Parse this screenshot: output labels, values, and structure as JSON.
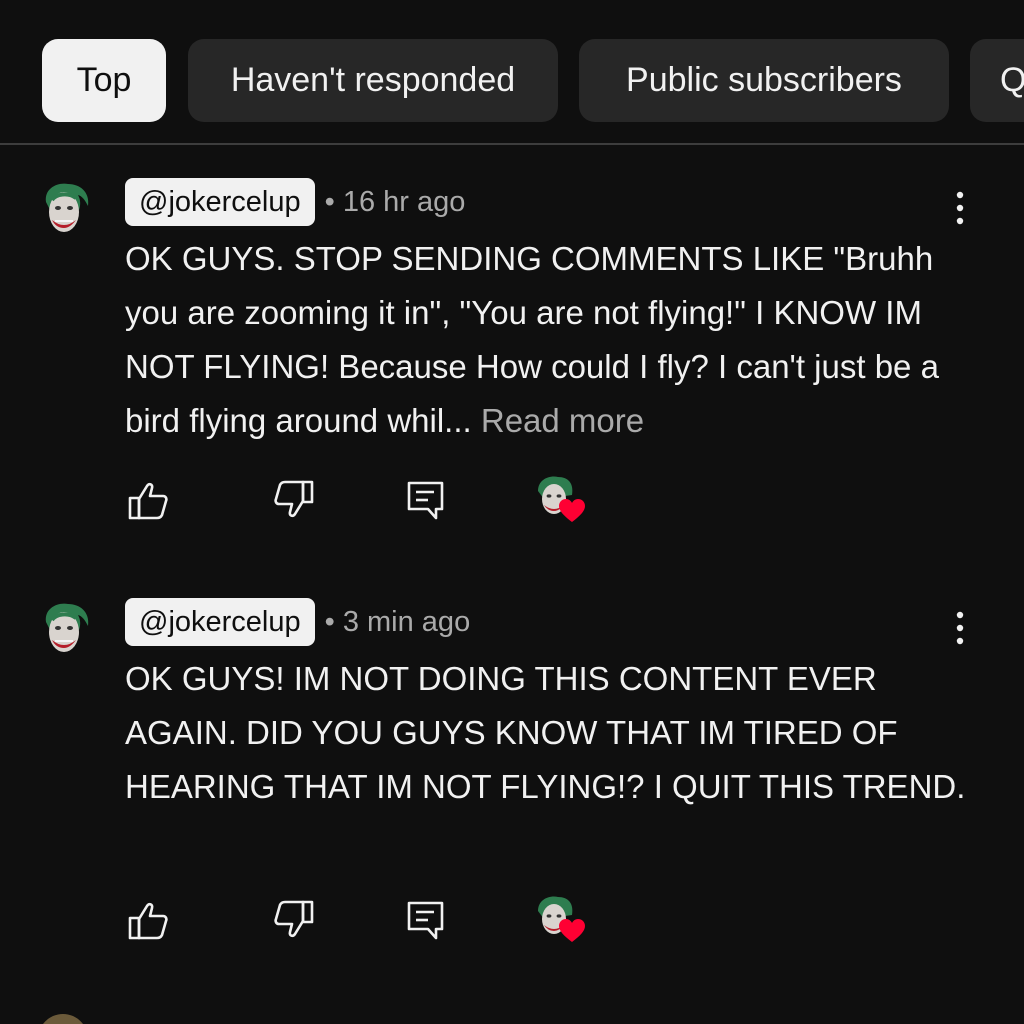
{
  "filters": {
    "chips": [
      {
        "label": "Top",
        "active": true
      },
      {
        "label": "Haven't responded",
        "active": false
      },
      {
        "label": "Public subscribers",
        "active": false
      },
      {
        "label": "Q",
        "active": false
      }
    ]
  },
  "comments": [
    {
      "author": "@jokercelup",
      "time": "• 16 hr ago",
      "text": "OK GUYS. STOP SENDING COMMENTS LIKE \"Bruhh you are zooming it in\", \"You are not flying!\" I KNOW IM NOT FLYING! Because How could I fly? I can't just be a bird flying around whil...",
      "read_more": "Read more",
      "hearted": true
    },
    {
      "author": "@jokercelup",
      "time": "• 3 min ago",
      "text": "OK GUYS! IM NOT DOING THIS CONTENT EVER AGAIN. DID YOU GUYS KNOW THAT IM TIRED OF HEARING THAT IM NOT FLYING!?  I QUIT THIS TREND.",
      "read_more": "",
      "hearted": true
    }
  ],
  "icons": {
    "like": "thumb-up-icon",
    "dislike": "thumb-down-icon",
    "reply": "reply-icon",
    "menu": "more-vert-icon",
    "heart": "heart-icon"
  },
  "colors": {
    "background": "#0f0f0f",
    "chip": "#272727",
    "chip_active": "#f1f1f1",
    "secondary_text": "#aaaaaa",
    "heart": "#ff0033"
  }
}
